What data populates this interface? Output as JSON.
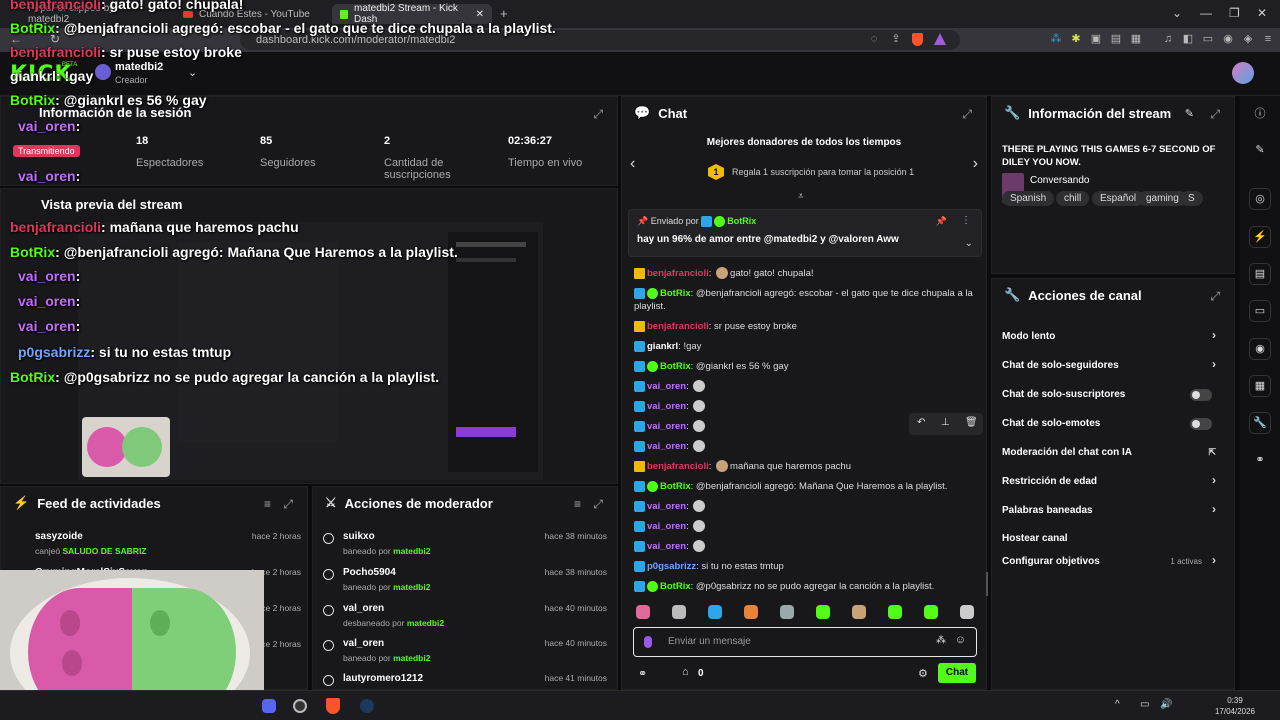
{
  "browser": {
    "tabs": [
      {
        "label": "PepuFor clipped by matedbi2"
      },
      {
        "label": "Cuando Estes - YouTube"
      },
      {
        "label": "matedbi2 Stream - Kick Dash"
      }
    ],
    "url": "dashboard.kick.com/moderator/matedbi2"
  },
  "header": {
    "logo": "KICK",
    "beta": "BETA",
    "channel": "matedbi2",
    "role": "Creador"
  },
  "session": {
    "title": "Información de la sesión",
    "stats": [
      {
        "value": "18",
        "label": "Espectadores"
      },
      {
        "value": "85",
        "label": "Seguidores"
      },
      {
        "value": "2",
        "label": "Cantidad de suscripciones"
      },
      {
        "value": "02:36:27",
        "label": "Tiempo en vivo"
      }
    ],
    "live_badge": "Transmitiendo"
  },
  "preview": {
    "title": "Vista previa del stream"
  },
  "overlay": [
    {
      "user": "benjafrancioli",
      "text": "gato! gato! chupala!"
    },
    {
      "user": "BotRix",
      "text": "@benjafrancioli agregó: escobar - el gato que te dice chupala a la playlist."
    },
    {
      "user": "benjafrancioli",
      "text": "sr puse estoy broke"
    },
    {
      "user": "giankrl",
      "text": "!gay"
    },
    {
      "user": "BotRix",
      "text": "@giankrl es 56 % gay"
    },
    {
      "user": "vai_oren",
      "text": ""
    },
    {
      "user": "vai_oren",
      "text": ""
    },
    {
      "user": "vai_oren",
      "text": ""
    },
    {
      "user": "benjafrancioli",
      "text": "mañana que haremos pachu"
    },
    {
      "user": "BotRix",
      "text": "@benjafrancioli agregó: Mañana Que Haremos a la playlist."
    },
    {
      "user": "vai_oren",
      "text": ""
    },
    {
      "user": "vai_oren",
      "text": ""
    },
    {
      "user": "vai_oren",
      "text": ""
    },
    {
      "user": "p0gsabrizz",
      "text": "si tu no estas tmtup"
    },
    {
      "user": "BotRix",
      "text": "@p0gsabrizz no se pudo agregar la canción a la playlist."
    }
  ],
  "chat": {
    "title": "Chat",
    "donors_title": "Mejores donadores de todos los tiempos",
    "donors_rank": "1",
    "donors_text": "Regala 1 suscripción para tomar la posición 1",
    "pinned_by": "Enviado por",
    "pinned_user": "BotRix",
    "pinned_text": "hay un 96% de amor entre @matedbi2 y @valoren Aww",
    "messages": [
      {
        "user": "benjafrancioli",
        "color": "#e0365c",
        "text": "gato! gato! chupala!"
      },
      {
        "user": "BotRix",
        "color": "#53fc18",
        "text": "@benjafrancioli agregó: escobar - el gato que te dice chupala a la"
      },
      {
        "user": "",
        "color": "#53fc18",
        "text": "playlist."
      },
      {
        "user": "benjafrancioli",
        "color": "#e0365c",
        "text": "sr puse estoy broke"
      },
      {
        "user": "giankrl",
        "color": "#ffffff",
        "text": "!gay"
      },
      {
        "user": "BotRix",
        "color": "#53fc18",
        "text": "@giankrl es 56 % gay"
      },
      {
        "user": "vai_oren",
        "color": "#c26bff",
        "text": ""
      },
      {
        "user": "vai_oren",
        "color": "#c26bff",
        "text": ""
      },
      {
        "user": "vai_oren",
        "color": "#c26bff",
        "text": ""
      },
      {
        "user": "vai_oren",
        "color": "#c26bff",
        "text": ""
      },
      {
        "user": "benjafrancioli",
        "color": "#e0365c",
        "text": "mañana que haremos pachu"
      },
      {
        "user": "BotRix",
        "color": "#53fc18",
        "text": "@benjafrancioli agregó: Mañana Que Haremos a la playlist."
      },
      {
        "user": "vai_oren",
        "color": "#c26bff",
        "text": ""
      },
      {
        "user": "vai_oren",
        "color": "#c26bff",
        "text": ""
      },
      {
        "user": "vai_oren",
        "color": "#c26bff",
        "text": ""
      },
      {
        "user": "p0gsabrizz",
        "color": "#6aa8ff",
        "text": "si tu no estas tmtup"
      },
      {
        "user": "BotRix",
        "color": "#53fc18",
        "text": "@p0gsabrizz no se pudo agregar la canción a la playlist."
      }
    ],
    "input_placeholder": "Enviar un mensaje",
    "points": "0",
    "send_label": "Chat"
  },
  "stream_info": {
    "title": "Información del stream",
    "stream_title": "THERE PLAYING THIS GAMES 6-7 SECOND OF DILEY YOU NOW.",
    "category": "Conversando",
    "tags": [
      "Spanish",
      "chill",
      "Español",
      "gaming",
      "S"
    ]
  },
  "channel_actions": {
    "title": "Acciones de canal",
    "items": [
      {
        "label": "Modo lento",
        "type": "chevron"
      },
      {
        "label": "Chat de solo-seguidores",
        "type": "chevron"
      },
      {
        "label": "Chat de solo-suscriptores",
        "type": "toggle"
      },
      {
        "label": "Chat de solo-emotes",
        "type": "toggle"
      },
      {
        "label": "Moderación del chat con IA",
        "type": "external"
      },
      {
        "label": "Restricción de edad",
        "type": "chevron"
      },
      {
        "label": "Palabras baneadas",
        "type": "chevron"
      },
      {
        "label": "Hostear canal",
        "type": "none"
      },
      {
        "label": "Configurar objetivos",
        "type": "goals",
        "extra": "1 activas"
      }
    ]
  },
  "activity_feed": {
    "title": "Feed de actividades",
    "items": [
      {
        "name": "sasyzoide",
        "action": "canjeó",
        "reward": "SALUDO DE SABRIZ",
        "time": "hace 2 horas"
      },
      {
        "name": "GrumingMorelSixSeven",
        "action": "",
        "reward": "",
        "time": "hace 2 horas"
      }
    ],
    "times": [
      "hace 2 horas",
      "hace 2 horas",
      "hace 2 horas",
      "hace 2 horas"
    ]
  },
  "mod_actions": {
    "title": "Acciones de moderador",
    "items": [
      {
        "name": "suikxo",
        "action": "baneado por",
        "by": "matedbi2",
        "time": "hace 38 minutos"
      },
      {
        "name": "Pocho5904",
        "action": "baneado por",
        "by": "matedbi2",
        "time": "hace 38 minutos"
      },
      {
        "name": "val_oren",
        "action": "desbaneado por",
        "by": "matedbi2",
        "time": "hace 40 minutos"
      },
      {
        "name": "val_oren",
        "action": "baneado por",
        "by": "matedbi2",
        "time": "hace 40 minutos"
      },
      {
        "name": "lautyromero1212",
        "action": "",
        "by": "",
        "time": "hace 41 minutos"
      }
    ]
  },
  "taskbar": {
    "time": "0:39",
    "date": "17/04/2026"
  },
  "colors": {
    "kick_green": "#53fc18",
    "panel": "#18181b",
    "bg": "#0b0b0d"
  }
}
